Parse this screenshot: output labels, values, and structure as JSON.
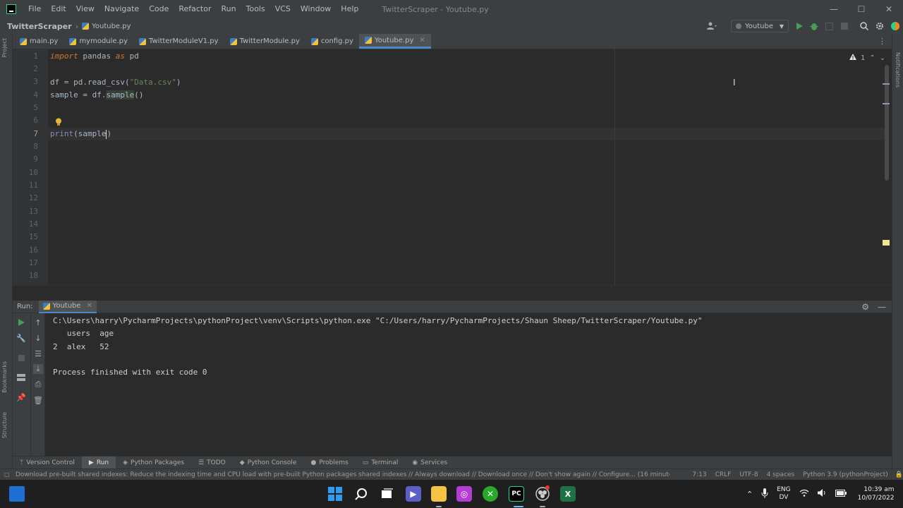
{
  "menu": [
    "File",
    "Edit",
    "View",
    "Navigate",
    "Code",
    "Refactor",
    "Run",
    "Tools",
    "VCS",
    "Window",
    "Help"
  ],
  "window_title": "TwitterScraper - Youtube.py",
  "window_controls": {
    "minimize": "—",
    "maximize": "☐",
    "close": "✕"
  },
  "breadcrumb": {
    "project": "TwitterScraper",
    "file": "Youtube.py"
  },
  "run_config": "Youtube",
  "left_stripe": {
    "project": "Project",
    "bookmarks": "Bookmarks",
    "structure": "Structure"
  },
  "right_stripe": {
    "notifications": "Notifications"
  },
  "tabs": [
    {
      "label": "main.py",
      "active": false
    },
    {
      "label": "mymodule.py",
      "active": false
    },
    {
      "label": "TwitterModuleV1.py",
      "active": false
    },
    {
      "label": "TwitterModule.py",
      "active": false
    },
    {
      "label": "config.py",
      "active": false
    },
    {
      "label": "Youtube.py",
      "active": true
    }
  ],
  "editor": {
    "line_numbers": [
      "1",
      "2",
      "3",
      "4",
      "5",
      "6",
      "7",
      "8",
      "9",
      "10",
      "11",
      "12",
      "13",
      "14",
      "15",
      "16",
      "17",
      "18"
    ],
    "current_line": 7,
    "inspection_count": "1",
    "code": {
      "l1_kw1": "import",
      "l1_mod": " pandas ",
      "l1_kw2": "as",
      "l1_alias": " pd",
      "l3_a": "df ",
      "l3_eq": "=",
      "l3_b": " pd.",
      "l3_fn": "read_csv",
      "l3_c": "(",
      "l3_str": "\"Data.csv\"",
      "l3_d": ")",
      "l4_a": "sample ",
      "l4_eq": "=",
      "l4_b": " df.",
      "l4_fn": "sample",
      "l4_c": "()",
      "l7_fn": "print",
      "l7_a": "(sample",
      "l7_b": ")"
    }
  },
  "run_panel": {
    "label": "Run:",
    "tab": "Youtube",
    "console": [
      "C:\\Users\\harry\\PycharmProjects\\pythonProject\\venv\\Scripts\\python.exe \"C:/Users/harry/PycharmProjects/Shaun Sheep/TwitterScraper/Youtube.py\"",
      "   users  age",
      "2  alex   52",
      "",
      "Process finished with exit code 0"
    ]
  },
  "tool_tabs": [
    {
      "label": "Version Control",
      "icon": "branch-icon",
      "active": false
    },
    {
      "label": "Run",
      "icon": "play-icon",
      "active": true
    },
    {
      "label": "Python Packages",
      "icon": "packages-icon",
      "active": false
    },
    {
      "label": "TODO",
      "icon": "list-icon",
      "active": false
    },
    {
      "label": "Python Console",
      "icon": "console-icon",
      "active": false
    },
    {
      "label": "Problems",
      "icon": "problems-icon",
      "active": false
    },
    {
      "label": "Terminal",
      "icon": "terminal-icon",
      "active": false
    },
    {
      "label": "Services",
      "icon": "services-icon",
      "active": false
    }
  ],
  "status_bar": {
    "message": "Download pre-built shared indexes: Reduce the indexing time and CPU load with pre-built Python packages shared indexes // Always download // Download once // Don't show again // Configure... (16 minutes",
    "position": "7:13",
    "line_sep": "CRLF",
    "encoding": "UTF-8",
    "indent": "4 spaces",
    "interpreter": "Python 3.9 (pythonProject)"
  },
  "taskbar": {
    "lang_top": "ENG",
    "lang_bottom": "DV",
    "time": "10:39 am",
    "date": "10/07/2022"
  },
  "colors": {
    "accent": "#4a88c7",
    "keyword": "#cc7832",
    "string": "#6a8759",
    "builtin": "#8888c6"
  }
}
